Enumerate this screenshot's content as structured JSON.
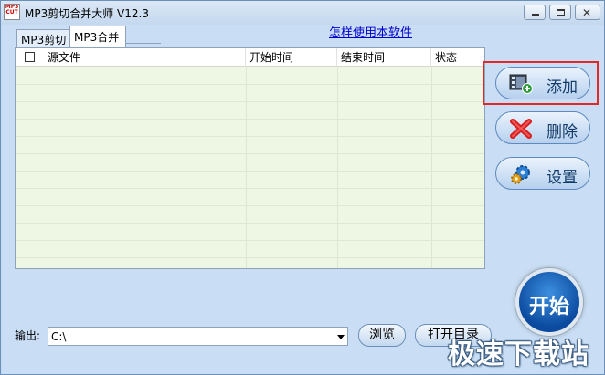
{
  "window": {
    "title": "MP3剪切合并大师 V12.3",
    "icon_text": [
      "MP3",
      "CUT"
    ],
    "minimize_icon": "minimize-icon",
    "maximize_icon": "maximize-icon",
    "close_icon": "close-icon"
  },
  "tabs": [
    {
      "label": "MP3剪切",
      "active": false
    },
    {
      "label": "MP3合并",
      "active": true
    }
  ],
  "help_link": "怎样使用本软件",
  "list": {
    "columns": [
      "源文件",
      "开始时间",
      "结束时间",
      "状态"
    ],
    "rows": []
  },
  "actions": {
    "add_label": "添加",
    "delete_label": "删除",
    "settings_label": "设置",
    "start_label": "开始"
  },
  "output": {
    "label": "输出:",
    "path": "C:\\"
  },
  "buttons": {
    "browse_label": "浏览",
    "open_dir_label": "打开目录"
  },
  "watermark": "极速下载站",
  "colors": {
    "highlight": "#e02828",
    "start_button": "#0b4a9e",
    "link": "#0000cc"
  }
}
